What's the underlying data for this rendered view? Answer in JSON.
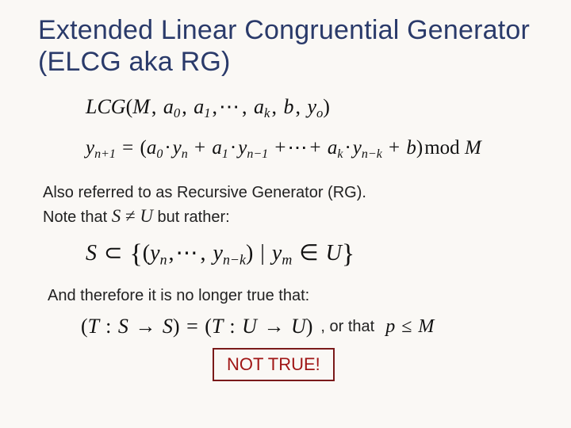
{
  "title": "Extended Linear Congruential Generator (ELCG aka RG)",
  "formula_def": "LCG(M, a₀, a₁, … , aₖ, b, yₒ)",
  "formula_rec": "yₙ₊₁ = (a₀·yₙ + a₁·yₙ₋₁ + … + aₖ·yₙ₋ₖ + b) mod M",
  "text_rg_1": "Also referred to as Recursive Generator (RG).",
  "text_rg_2a": "Note that ",
  "formula_snu": "S ≠ U",
  "text_rg_2b": " but rather:",
  "formula_set": "S ⊂ {(yₙ, … , yₙ₋ₖ) | yₘ ∈ U}",
  "text_andtherefore": "And therefore it is no longer true that:",
  "formula_tss": "(T : S → S) = (T : U → U)",
  "text_orthat": ", or that",
  "formula_ple": "p ≤ M",
  "not_true": "NOT TRUE!"
}
